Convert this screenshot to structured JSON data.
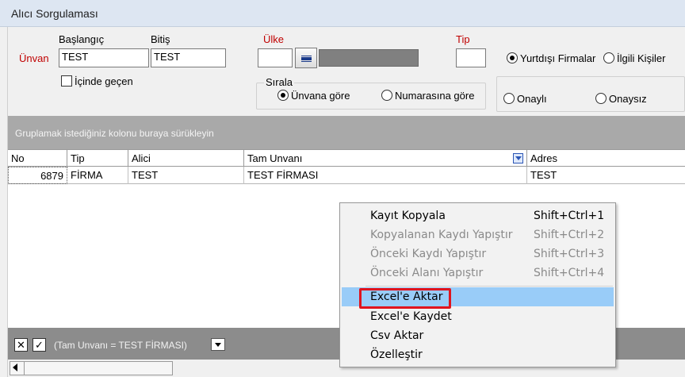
{
  "window": {
    "title": "Alıcı Sorgulaması"
  },
  "filters": {
    "unvan_label": "Ünvan",
    "baslangic_label": "Başlangıç",
    "baslangic_value": "TEST",
    "bitis_label": "Bitiş",
    "bitis_value": "TEST",
    "icinde_gecen_label": "İçinde geçen",
    "icinde_gecen_checked": false,
    "ulke_label": "Ülke",
    "ulke_value": "",
    "tip_label": "Tip",
    "tip_value": "",
    "scope_options": [
      {
        "label": "Yurtdışı Firmalar",
        "selected": true
      },
      {
        "label": "İlgili Kişiler",
        "selected": false
      }
    ],
    "sirala_label": "Sırala",
    "sort_options": [
      {
        "label": "Ünvana göre",
        "selected": true
      },
      {
        "label": "Numarasına göre",
        "selected": false
      }
    ],
    "approval_options": [
      {
        "label": "Onaylı",
        "selected": false
      },
      {
        "label": "Onaysız",
        "selected": false
      }
    ]
  },
  "group_bar": {
    "hint": "Gruplamak istediğiniz kolonu buraya sürükleyin"
  },
  "grid": {
    "columns": [
      "No",
      "Tip",
      "Alici",
      "Tam Unvanı",
      "Adres"
    ],
    "rows": [
      {
        "no": "6879",
        "tip": "FİRMA",
        "alici": "TEST",
        "tam_unvani": "TEST FİRMASI",
        "adres": "TEST"
      }
    ]
  },
  "filter_bar": {
    "close_glyph": "✕",
    "check_glyph": "✓",
    "expression": "(Tam Unvanı = TEST FİRMASI)"
  },
  "context_menu": {
    "items": [
      {
        "label": "Kayıt Kopyala",
        "shortcut": "Shift+Ctrl+1",
        "enabled": true
      },
      {
        "label": "Kopyalanan Kaydı Yapıştır",
        "shortcut": "Shift+Ctrl+2",
        "enabled": false
      },
      {
        "label": "Önceki Kaydı Yapıştır",
        "shortcut": "Shift+Ctrl+3",
        "enabled": false
      },
      {
        "label": "Önceki Alanı Yapıştır",
        "shortcut": "Shift+Ctrl+4",
        "enabled": false
      },
      {
        "label": "Excel'e Aktar",
        "shortcut": "",
        "enabled": true,
        "highlighted": true
      },
      {
        "label": "Excel'e Kaydet",
        "shortcut": "",
        "enabled": true
      },
      {
        "label": "Csv Aktar",
        "shortcut": "",
        "enabled": true
      },
      {
        "label": "Özelleştir",
        "shortcut": "",
        "enabled": true
      }
    ]
  },
  "colors": {
    "title_bar": "#dde6f2",
    "panel": "#f0f0f0",
    "group_bar": "#a9a9a9",
    "filter_bar": "#8c8c8c",
    "menu_highlight": "#99ccf8",
    "highlight_box": "#e0141e",
    "required_label": "#c00000"
  }
}
